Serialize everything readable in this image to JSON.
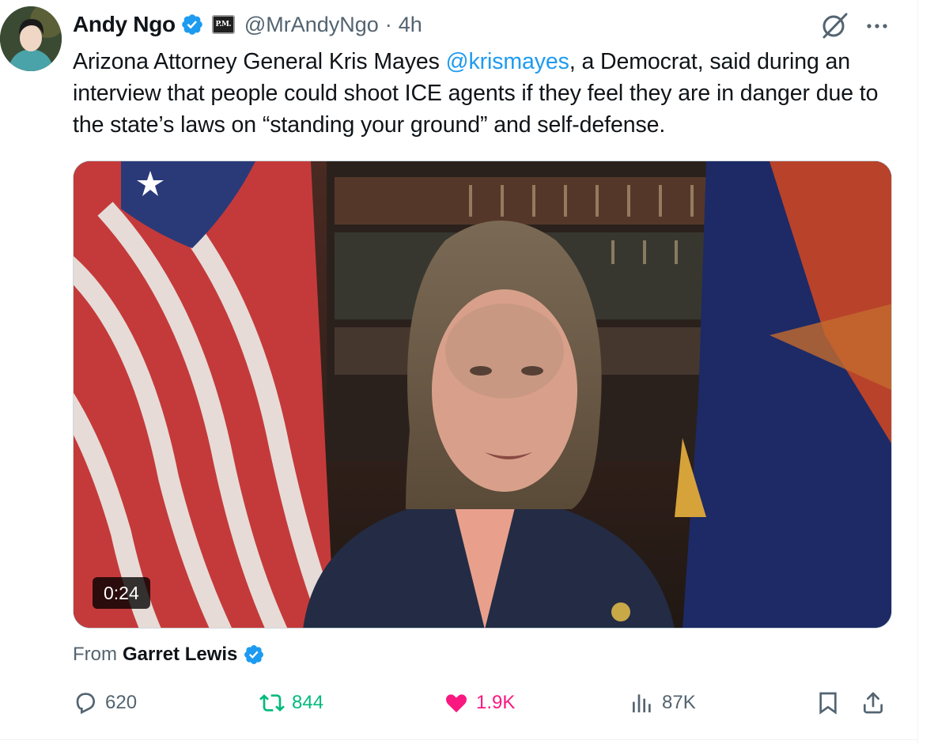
{
  "post": {
    "author": {
      "display_name": "Andy Ngo",
      "handle": "@MrAndyNgo",
      "affiliate_badge": "P.M.",
      "verified": true
    },
    "separator": "·",
    "timestamp": "4h",
    "text": {
      "before_mention": "Arizona Attorney General Kris Mayes ",
      "mention": "@krismayes",
      "after_mention": ", a Democrat, said during an interview that people could shoot ICE agents if they feel they are in danger due to the state’s laws on “standing your ground” and self-defense."
    },
    "video": {
      "duration": "0:24"
    },
    "source": {
      "prefix": "From",
      "name": "Garret Lewis",
      "verified": true
    },
    "metrics": {
      "replies": "620",
      "reposts": "844",
      "likes": "1.9K",
      "views": "87K"
    }
  },
  "icons": {
    "verified": "verified-badge-icon",
    "grok": "grok-icon",
    "more": "more-icon",
    "reply": "reply-icon",
    "repost": "repost-icon",
    "like": "heart-icon",
    "views": "views-icon",
    "bookmark": "bookmark-icon",
    "share": "share-icon"
  },
  "colors": {
    "text": "#0f1419",
    "secondary": "#536471",
    "link": "#1d9bf0",
    "repost_active": "#00ba7c",
    "like_active": "#f91880"
  }
}
